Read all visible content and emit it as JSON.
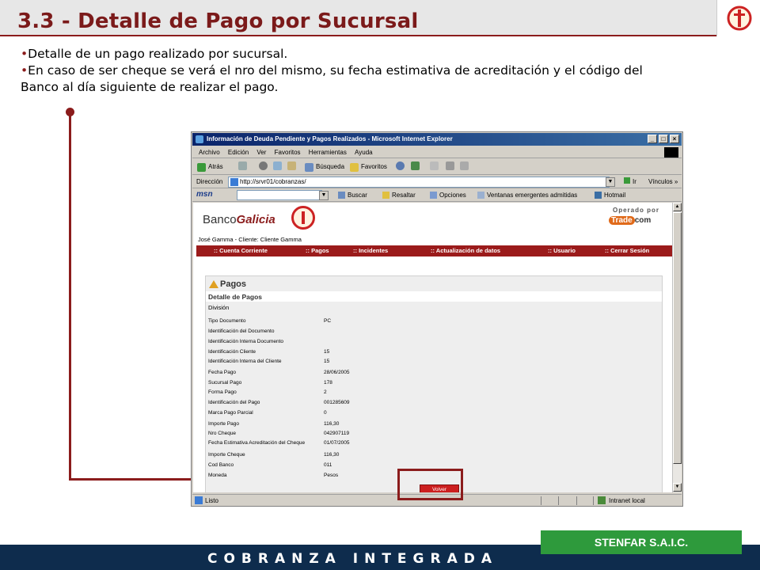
{
  "slide": {
    "title": "3.3 - Detalle de Pago por Sucursal",
    "bullets": [
      "Detalle de un pago realizado por sucursal.",
      "En caso de ser cheque se verá el nro del mismo, su fecha estimativa de acreditación y el código del",
      "Banco al día siguiente de realizar el pago."
    ],
    "bullet_marker": "•",
    "accent_color": "#8b1c1c",
    "footer_text": "COBRANZA INTEGRADA",
    "company": "STENFAR S.A.I.C."
  },
  "browser": {
    "window_title": "Información de Deuda Pendiente y Pagos Realizados - Microsoft Internet Explorer",
    "menu": [
      "Archivo",
      "Edición",
      "Ver",
      "Favoritos",
      "Herramientas",
      "Ayuda"
    ],
    "toolbar": {
      "back": "Atrás",
      "search": "Búsqueda",
      "favorites": "Favoritos"
    },
    "address_label": "Dirección",
    "address": "http://srvr01/cobranzas/",
    "go": "Ir",
    "links": "Vínculos",
    "msn": {
      "logo": "msn",
      "search": "Buscar",
      "highlight": "Resaltar",
      "options": "Opciones",
      "popups": "Ventanas emergentes admitidas",
      "hotmail": "Hotmail"
    },
    "status": "Listo",
    "zone": "Intranet local"
  },
  "site": {
    "bank_prefix": "Banco",
    "bank_suffix": "Galicia",
    "operated_by": "Operado por",
    "trade_part1": "Trade",
    "trade_part2": "com",
    "client_line": "José Gamma - Cliente: Cliente Gamma",
    "nav": [
      ":: Cuenta Corriente",
      ":: Pagos",
      ":: Incidentes",
      ":: Actualización de datos",
      ":: Usuario",
      ":: Cerrar Sesión"
    ],
    "panel_title": "Pagos",
    "section_title": "Detalle de Pagos",
    "division": "División",
    "rows": [
      {
        "label": "Tipo Documento",
        "value": "PC"
      },
      {
        "label": "Identificación del Documento",
        "value": ""
      },
      {
        "label": "Identificación Interna Documento",
        "value": ""
      },
      {
        "label": "Identificación Cliente",
        "value": "15"
      },
      {
        "label": "Identificación Interna del Cliente",
        "value": "15"
      },
      {
        "label": "Fecha Pago",
        "value": "28/06/2005"
      },
      {
        "label": "Sucursal Pago",
        "value": "178"
      },
      {
        "label": "Forma Pago",
        "value": "2"
      },
      {
        "label": "Identificación del Pago",
        "value": "001285609"
      },
      {
        "label": "Marca Pago Parcial",
        "value": "0"
      },
      {
        "label": "Importe Pago",
        "value": "116,30"
      },
      {
        "label": "Nro Cheque",
        "value": "042907119"
      },
      {
        "label": "Fecha Estimativa Acreditación del Cheque",
        "value": "01/07/2005"
      },
      {
        "label": "Importe Cheque",
        "value": "116,30"
      },
      {
        "label": "Cod Banco",
        "value": "011"
      },
      {
        "label": "Moneda",
        "value": "Pesos"
      }
    ],
    "volver": "Volver"
  }
}
